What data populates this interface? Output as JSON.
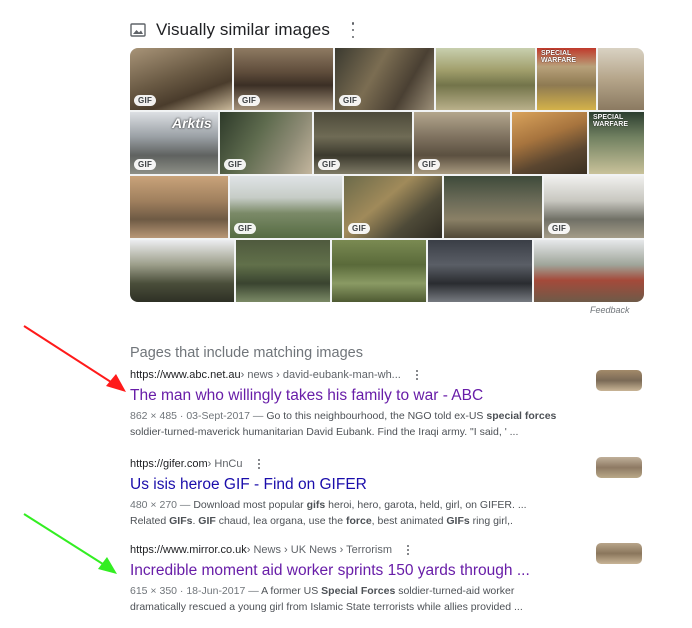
{
  "visually_similar": {
    "title": "Visually similar images",
    "badge": "GIF",
    "overlay_brand": "Arktis",
    "poster_text_1": "SPECIAL WARFARE",
    "poster_text_2": "SPECIAL WARFARE",
    "feedback": "Feedback"
  },
  "pages": {
    "title": "Pages that include matching images",
    "results": [
      {
        "url_domain": "https://www.abc.net.au",
        "url_path": " › news › david-eubank-man-wh...",
        "title": "The man who willingly takes his family to war - ABC",
        "meta": "862 × 485 · 03-Sept-2017 — ",
        "snippet_line1_pre": "Go to this neighbourhood, the NGO told ex-US ",
        "snippet_line1_bold": "special forces",
        "snippet_line2": "soldier-turned-maverick humanitarian David Eubank. Find the Iraqi army. \"I said, ' ..."
      },
      {
        "url_domain": "https://gifer.com",
        "url_path": " › HnCu",
        "title": "Us isis heroe GIF - Find on GIFER",
        "meta": "480 × 270 — ",
        "snippet_line1_pre": "Download most popular ",
        "snippet_line1_bold": "gifs",
        "snippet_line1_post": " heroi, hero, garota, held, girl, on GIFER. ...",
        "snippet_line2_a": "Related ",
        "snippet_line2_b1": "GIFs",
        "snippet_line2_c": ". ",
        "snippet_line2_b2": "GIF",
        "snippet_line2_d": " chaud, lea organa, use the ",
        "snippet_line2_b3": "force",
        "snippet_line2_e": ", best animated ",
        "snippet_line2_b4": "GIFs",
        "snippet_line2_f": " ring girl,."
      },
      {
        "url_domain": "https://www.mirror.co.uk",
        "url_path": " › News › UK News › Terrorism",
        "title": "Incredible moment aid worker sprints 150 yards through ...",
        "meta": "615 × 350 · 18-Jun-2017 — ",
        "snippet_line1_pre": "A former US ",
        "snippet_line1_bold": "Special Forces",
        "snippet_line1_post": " soldier-turned-aid worker",
        "snippet_line2": "dramatically rescued a young girl from Islamic State terrorists while allies provided ..."
      }
    ]
  },
  "colors": {
    "link_visited": "#681da8",
    "link_unvisited": "#1a0dab",
    "red_arrow": "#ff1a1a",
    "green_arrow": "#33ee22"
  },
  "icons": {
    "header": "image-icon",
    "more": "more-vert-icon"
  }
}
